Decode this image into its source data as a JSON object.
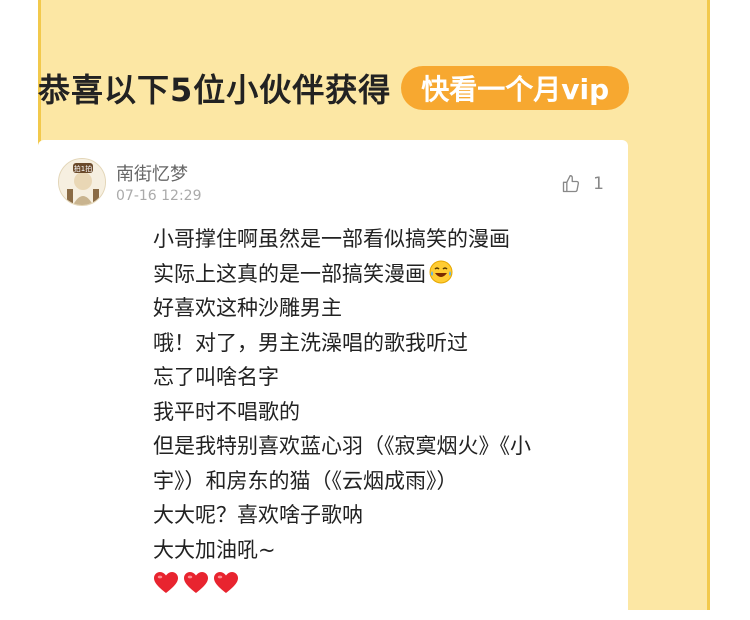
{
  "banner": {
    "headline": "恭喜以下5位小伙伴获得",
    "prize": "快看一个月vip"
  },
  "comment": {
    "username": "南街忆梦",
    "timestamp": "07-16 12:29",
    "like_count": "1",
    "lines": [
      "小哥撑住啊虽然是一部看似搞笑的漫画",
      "实际上这真的是一部搞笑漫画",
      "好喜欢这种沙雕男主",
      "哦！对了，男主洗澡唱的歌我听过",
      "忘了叫啥名字",
      "我平时不唱歌的",
      "但是我特别喜欢蓝心羽（《寂寞烟火》《小",
      "宇》）和房东的猫（《云烟成雨》）",
      "大大呢？喜欢啥子歌呐",
      "大大加油吼~"
    ],
    "inline_emoji": "laughing-with-tears-icon",
    "trailing_emojis": [
      "red-heart-icon",
      "red-heart-icon",
      "red-heart-icon"
    ],
    "avatar_badge": "拍1拍"
  },
  "colors": {
    "frame_bg": "#fce7a4",
    "frame_border": "#f2c94c",
    "pill_bg": "#f7a830",
    "heart": "#e8242f"
  }
}
